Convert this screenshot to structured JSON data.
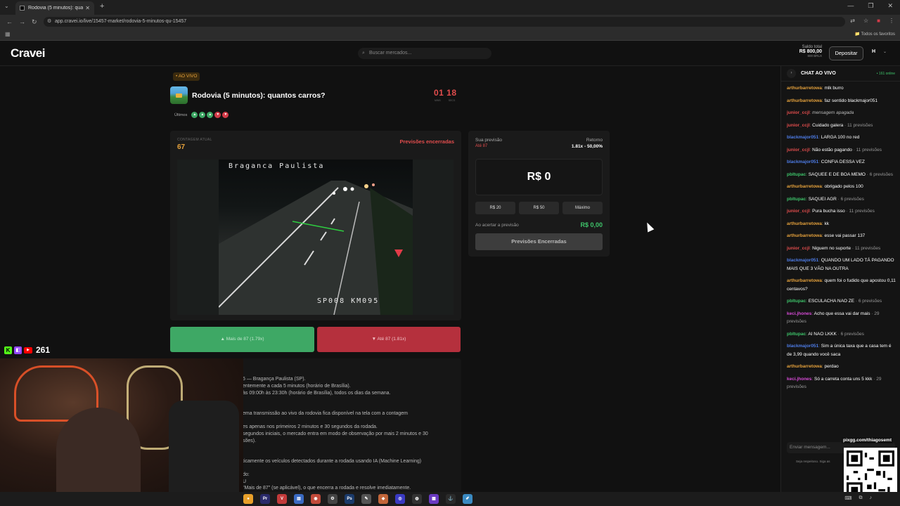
{
  "browser": {
    "tab_title": "Rodovia (5 minutos): quantos c",
    "url": "app.cravei.io/live/15457-market/rodovia-5-minutos-qu-15457",
    "bookmarks_folder": "Todos os favoritos"
  },
  "site": {
    "logo": "Cravei",
    "search_placeholder": "Buscar mercados...",
    "balance": {
      "label": "Saldo total",
      "value": "R$ 800,00",
      "sub": "800 BRLX"
    },
    "deposit_label": "Depositar",
    "user_initial": "H"
  },
  "market": {
    "live_badge": "• AO VIVO",
    "title": "Rodovia (5 minutos): quantos carros?",
    "timer": "01 18",
    "timer_labels": [
      "MINS",
      "SECS"
    ],
    "last_label": "Últimos",
    "last_results": [
      "up",
      "up",
      "up",
      "down",
      "down"
    ],
    "count_label": "CONTAGEM ATUAL",
    "count_value": "67",
    "status": "Previsões encerradas",
    "video_top_text": "Braganca Paulista",
    "video_bottom_text": "SP008 KM095",
    "bet_over": "Mais de 87 (1.79x)",
    "bet_under": "Até 87 (1.81x)"
  },
  "description": [
    "5 — Bragança Paulista (SP).",
    "entemente a cada 5 minutos (horário de Brasília).",
    "às 09:00h às 23:30h (horário de Brasília), todos os dias da semana.",
    "ema transmissão ao vivo da rodovia fica disponível na tela com a contagem",
    "es apenas nos primeiros 2 minutos e 30 segundos da rodada.",
    "segundos iniciais, o mercado entra em modo de observação por mais 2 minutos e 30",
    "sões).",
    "ticamente os veículos detectados durante a rodada usando IA (Machine Learning)",
    "do:",
    "U",
    "\"Mais de 87\" (se aplicável), o que encerra a rodada e resolve imediatamente."
  ],
  "prediction": {
    "your_label": "Sua previsão",
    "your_value": "Até 87",
    "return_label": "Retorno",
    "return_value": "1.81x - 50,00%",
    "amount": "R$ 0",
    "quick": [
      "R$ 20",
      "R$ 50",
      "Máximo"
    ],
    "win_label": "Ao acertar a previsão",
    "win_value": "R$ 0,00",
    "closed_button": "Previsões Encerradas"
  },
  "chat": {
    "title": "CHAT AO VIVO",
    "online": "• 161 online",
    "input_placeholder": "Enviar mensagem...",
    "footer": "Seja respeitoso. Siga as",
    "messages": [
      {
        "user": "arthurbarretowa",
        "color": "#e6a23c",
        "text": "mlk burro",
        "note": ""
      },
      {
        "user": "arthurbarretowa",
        "color": "#e6a23c",
        "text": "faz sentido blackmajor051",
        "note": ""
      },
      {
        "user": "junior_ccjl",
        "color": "#e24d4d",
        "text": "",
        "note": "",
        "italic": "mensagem apagada"
      },
      {
        "user": "junior_ccjl",
        "color": "#e24d4d",
        "text": "Cuidado galera",
        "note": " · 11 previsões"
      },
      {
        "user": "blackmajor051",
        "color": "#4e7de9",
        "text": "LARGA 100 no red",
        "note": ""
      },
      {
        "user": "junior_ccjl",
        "color": "#e24d4d",
        "text": "Não estão pagando",
        "note": " · 11 previsões"
      },
      {
        "user": "blackmajor051",
        "color": "#4e7de9",
        "text": "CONFIA DESSA VEZ",
        "note": ""
      },
      {
        "user": "pbltupac",
        "color": "#3ec46a",
        "text": "SAQUEE E DE BOA MEMO",
        "note": " · 6 previsões"
      },
      {
        "user": "arthurbarretowa",
        "color": "#e6a23c",
        "text": "obrigado pelos 100",
        "note": ""
      },
      {
        "user": "pbltupac",
        "color": "#3ec46a",
        "text": "SAQUEI AGR",
        "note": " · 6 previsões"
      },
      {
        "user": "junior_ccjl",
        "color": "#e24d4d",
        "text": "Pura bucha isso",
        "note": " · 11 previsões"
      },
      {
        "user": "arthurbarretowa",
        "color": "#e6a23c",
        "text": "kk",
        "note": ""
      },
      {
        "user": "arthurbarretowa",
        "color": "#e6a23c",
        "text": "esse vai passar 137",
        "note": ""
      },
      {
        "user": "junior_ccjl",
        "color": "#e24d4d",
        "text": "Niguem no suporte",
        "note": " · 11 previsões"
      },
      {
        "user": "blackmajor051",
        "color": "#4e7de9",
        "text": "QUANDO UM LADO TÁ PAGANDO MAIS QUE 3 VÃO NA OUTRA",
        "note": ""
      },
      {
        "user": "arthurbarretowa",
        "color": "#e6a23c",
        "text": "quem foi o fudido que apostou 0,11 centavos?",
        "note": ""
      },
      {
        "user": "pbltupac",
        "color": "#3ec46a",
        "text": "ESCULACHA NAO ZE",
        "note": " · 6 previsões"
      },
      {
        "user": "keci.jhones",
        "color": "#d64bd6",
        "text": "Acho que essa vai dar mais",
        "note": " · 29 previsões"
      },
      {
        "user": "pbltupac",
        "color": "#3ec46a",
        "text": "AI NAO LKKK",
        "note": " · 6 previsões"
      },
      {
        "user": "blackmajor051",
        "color": "#4e7de9",
        "text": "Sim a única taxa que a casa tem é de 3,99 quando você saca",
        "note": ""
      },
      {
        "user": "arthurbarretowa",
        "color": "#e6a23c",
        "text": "perdao",
        "note": ""
      },
      {
        "user": "keci.jhones",
        "color": "#d64bd6",
        "text": "Só a carreta conta uns 5 kkk",
        "note": " · 29 previsões"
      }
    ]
  },
  "stream_overlay": {
    "viewer_count": "261",
    "pix_label": "pixgg.com/thiagosemt"
  }
}
